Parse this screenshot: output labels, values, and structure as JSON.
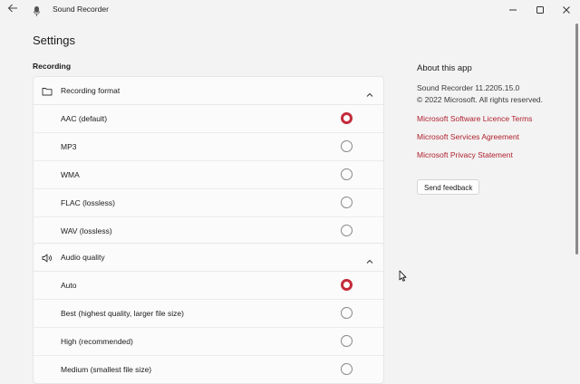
{
  "window": {
    "title": "Sound Recorder"
  },
  "settings": {
    "page_title": "Settings",
    "section_label": "Recording",
    "recording_format": {
      "header": "Recording format",
      "options": [
        {
          "label": "AAC (default)",
          "selected": true
        },
        {
          "label": "MP3",
          "selected": false
        },
        {
          "label": "WMA",
          "selected": false
        },
        {
          "label": "FLAC (lossless)",
          "selected": false
        },
        {
          "label": "WAV (lossless)",
          "selected": false
        }
      ]
    },
    "audio_quality": {
      "header": "Audio quality",
      "options": [
        {
          "label": "Auto",
          "selected": true
        },
        {
          "label": "Best (highest quality, larger file size)",
          "selected": false
        },
        {
          "label": "High (recommended)",
          "selected": false
        },
        {
          "label": "Medium (smallest file size)",
          "selected": false
        }
      ]
    }
  },
  "about": {
    "title": "About this app",
    "version": "Sound Recorder 11.2205.15.0",
    "copyright": "© 2022 Microsoft. All rights reserved.",
    "links": [
      "Microsoft Software Licence Terms",
      "Microsoft Services Agreement",
      "Microsoft Privacy Statement"
    ],
    "feedback_button": "Send feedback"
  },
  "colors": {
    "accent": "#c42b3a",
    "link": "#b0212f",
    "background": "#f3f3f3",
    "card": "#fbfbfb"
  },
  "icons": [
    "back-arrow-icon",
    "microphone-icon",
    "minimize-icon",
    "maximize-icon",
    "close-icon",
    "folder-icon",
    "speaker-icon",
    "chevron-up-icon"
  ]
}
